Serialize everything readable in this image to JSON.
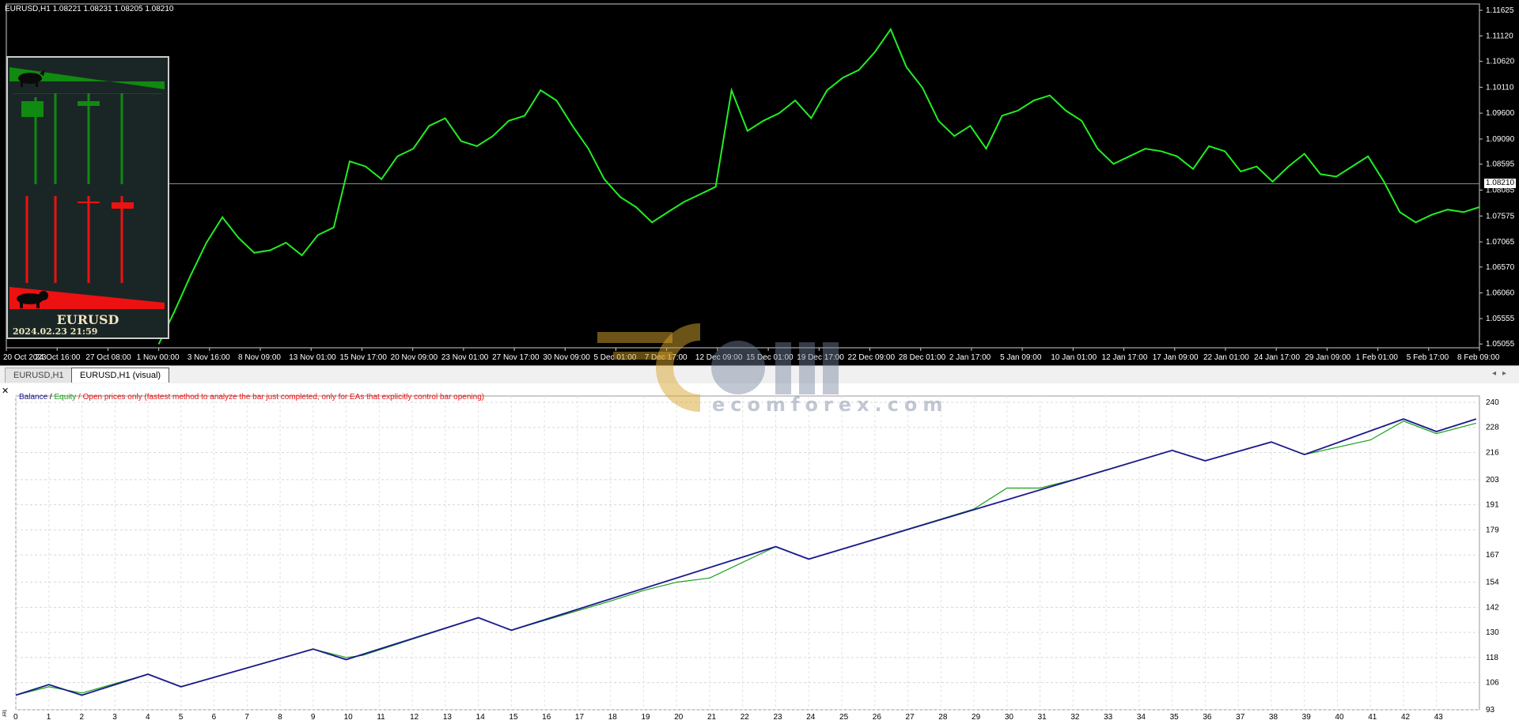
{
  "symbol_header": "EURUSD,H1  1.08221 1.08231 1.08205 1.08210",
  "colors": {
    "price_line": "#22ee22",
    "balance": "#1a1a8c",
    "equity": "#1aa01a",
    "chart_bg": "#000000",
    "bull": "#108a10",
    "bear": "#ee1111"
  },
  "ea_panel": {
    "symbol": "EURUSD",
    "datetime": "2024.02.23 21:59",
    "bull_icon": "bull-icon",
    "bear_icon": "bear-icon"
  },
  "current_price": "1.08210",
  "tabs": [
    {
      "label": "EURUSD,H1",
      "active": false
    },
    {
      "label": "EURUSD,H1 (visual)",
      "active": true
    }
  ],
  "report_legend": {
    "balance": "Balance",
    "sep": " / ",
    "equity": "Equity",
    "note": " / Open prices only (fastest method to analyze the bar just completed, only for EAs that explicitly control bar opening)"
  },
  "watermark": "ecomforex.com",
  "side_tab_label": "ter",
  "chart_data": [
    {
      "type": "line",
      "title": "EURUSD,H1",
      "y_ticks": [
        "1.11625",
        "1.11120",
        "1.10620",
        "1.10110",
        "1.09600",
        "1.09090",
        "1.08595",
        "1.08085",
        "1.07575",
        "1.07065",
        "1.06570",
        "1.06060",
        "1.05555",
        "1.05055"
      ],
      "x_ticks": [
        "20 Oct 2023",
        "24 Oct 16:00",
        "27 Oct 08:00",
        "1 Nov 00:00",
        "3 Nov 16:00",
        "8 Nov 09:00",
        "13 Nov 01:00",
        "15 Nov 17:00",
        "20 Nov 09:00",
        "23 Nov 01:00",
        "27 Nov 17:00",
        "30 Nov 09:00",
        "5 Dec 01:00",
        "7 Dec 17:00",
        "12 Dec 09:00",
        "15 Dec 01:00",
        "19 Dec 17:00",
        "22 Dec 09:00",
        "28 Dec 01:00",
        "2 Jan 17:00",
        "5 Jan 09:00",
        "10 Jan 01:00",
        "12 Jan 17:00",
        "17 Jan 09:00",
        "22 Jan 01:00",
        "24 Jan 17:00",
        "29 Jan 09:00",
        "1 Feb 01:00",
        "5 Feb 17:00",
        "8 Feb 09:00"
      ],
      "ylim": [
        1.0498,
        1.1175
      ],
      "series": [
        {
          "x_range": [
            "1 Nov 00:00",
            "8 Feb 09:00"
          ],
          "values": [
            1.0505,
            1.057,
            1.064,
            1.0705,
            1.0755,
            1.0715,
            1.0685,
            1.069,
            1.0705,
            1.068,
            1.072,
            1.0735,
            1.0865,
            1.0855,
            1.083,
            1.0875,
            1.089,
            1.0935,
            1.095,
            1.0905,
            1.0895,
            1.0915,
            1.0945,
            1.0955,
            1.1005,
            1.0985,
            1.0935,
            1.089,
            1.083,
            1.0795,
            1.0775,
            1.0745,
            1.0765,
            1.0785,
            1.08,
            1.0815,
            1.1005,
            1.0925,
            1.0945,
            1.096,
            1.0985,
            1.095,
            1.1005,
            1.103,
            1.1045,
            1.108,
            1.1125,
            1.105,
            1.101,
            1.0945,
            1.0915,
            1.0935,
            1.089,
            1.0955,
            1.0965,
            1.0985,
            1.0995,
            1.0965,
            1.0945,
            1.089,
            1.086,
            1.0875,
            1.089,
            1.0885,
            1.0875,
            1.085,
            1.0895,
            1.0885,
            1.0845,
            1.0855,
            1.0825,
            1.0855,
            1.088,
            1.084,
            1.0835,
            1.0855,
            1.0875,
            1.0825,
            1.0765,
            1.0745,
            1.076,
            1.077,
            1.0765,
            1.0775
          ]
        }
      ]
    },
    {
      "type": "line",
      "title": "",
      "y_ticks": [
        "240",
        "228",
        "216",
        "203",
        "191",
        "179",
        "167",
        "154",
        "142",
        "130",
        "118",
        "106",
        "93"
      ],
      "x_ticks": [
        "0",
        "1",
        "2",
        "3",
        "4",
        "5",
        "6",
        "7",
        "8",
        "9",
        "10",
        "11",
        "12",
        "13",
        "14",
        "15",
        "16",
        "17",
        "18",
        "19",
        "20",
        "21",
        "22",
        "23",
        "24",
        "25",
        "26",
        "27",
        "28",
        "29",
        "30",
        "31",
        "32",
        "33",
        "34",
        "35",
        "36",
        "37",
        "38",
        "39",
        "40",
        "41",
        "42",
        "43"
      ],
      "ylim": [
        93,
        243
      ],
      "series": [
        {
          "name": "Balance",
          "x": [
            0,
            1,
            2,
            4,
            5,
            9,
            10,
            14,
            15,
            23,
            24,
            35,
            36,
            38,
            39,
            42,
            43,
            44.2
          ],
          "values": [
            100,
            105,
            100,
            110,
            104,
            122,
            117,
            137,
            131,
            171,
            165,
            217,
            212,
            221,
            215,
            232,
            226,
            232
          ]
        },
        {
          "name": "Equity",
          "x": [
            0,
            1,
            2,
            4,
            5,
            9,
            10,
            10.5,
            14,
            15,
            18,
            19,
            20,
            21,
            23,
            24,
            29,
            30,
            31,
            32,
            35,
            36,
            38,
            39,
            41,
            42,
            43,
            44.2
          ],
          "values": [
            100,
            104,
            101,
            110,
            104,
            122,
            118,
            119,
            137,
            131,
            145,
            150,
            154,
            156,
            171,
            165,
            189,
            199,
            199,
            203,
            217,
            212,
            221,
            215,
            222,
            231,
            225,
            230
          ]
        }
      ]
    }
  ]
}
